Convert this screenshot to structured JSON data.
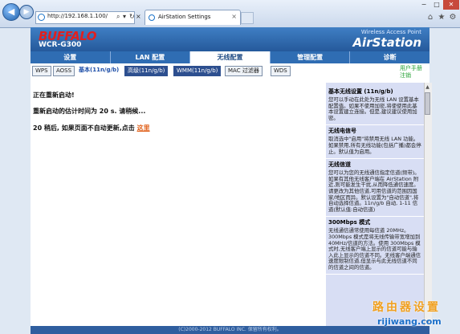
{
  "browser": {
    "url": "http://192.168.1.100/",
    "tab_title": "AirStation Settings",
    "tab_close": "×",
    "search_glyph": "⌕",
    "dropdown_glyph": "▾",
    "refresh_glyph": "↻",
    "stop_glyph": "×",
    "back_glyph": "◀",
    "forward_glyph": "▶",
    "minimize_glyph": "−",
    "maximize_glyph": "□",
    "close_glyph": "✕",
    "home_glyph": "⌂",
    "favorites_glyph": "★",
    "tools_glyph": "⚙"
  },
  "header": {
    "brand": "BUFFALO",
    "model": "WCR-G300",
    "product_sub": "Wireless Access Point",
    "product_name": "AirStation"
  },
  "nav": {
    "tabs": [
      {
        "label": "设置"
      },
      {
        "label": "LAN 配置"
      },
      {
        "label": "无线配置"
      },
      {
        "label": "管理配置"
      },
      {
        "label": "诊断"
      }
    ]
  },
  "subnav": {
    "items": [
      "WPS",
      "AOSS",
      "基本(11n/g/b)",
      "高级(11n/g/b)",
      "WMM(11n/g/b)",
      "MAC 过滤器",
      "WDS"
    ],
    "user_manual": "用户手册",
    "logout": "注销"
  },
  "main": {
    "line1": "正在重新启动!",
    "line2": "重新启动的估计时间为 20 s. 请稍候...",
    "line3": "20 稍后, 如果页面不自动更新,点击",
    "link": "这里"
  },
  "help": {
    "sections": [
      {
        "title": "基本无线设置 (11n/g/b)",
        "body": "您可以手动在此处为无线 LAN 设置基本配置值。如果不使用加密,将使使用此基本设置建立连接。但是,建议建议使用加密。"
      },
      {
        "title": "无线电信号",
        "body": "取消选中\"启用\"将禁用无线 LAN 功能。如果禁用,所有无线功能(包括广播)都会停止。默认值为启用。"
      },
      {
        "title": "无线信道",
        "body": "您可以为您的无线通信指定信道(频带)。如果有其他无线客户端在 AirStation 附近,则可能发生干扰,从而降低通信速度。请更改为其他信道,可用信道的范围因国家/地区而异。默认设置为\"自动信道\",将自动选择信道。11n/g/b 自动, 1-11 信道(默认值:自动信道)"
      },
      {
        "title": "300Mbps 模式",
        "body": "无线通信通常使用每信道 20MHz。300Mbps 模式是将无线传输带宽增加到 40MHz/信道的方法。使用 300Mbps 模式时,无线客户端上显示的信道可能与输入此上显示的信道不同。无线客户端通信速度限制信道,但显示与此无线信道不同的信道之间的信道。"
      }
    ]
  },
  "footer": {
    "text": "(C)2000-2012 BUFFALO INC. 保留所有权利。"
  },
  "watermark": {
    "line1": "路由器设置",
    "line2": "rijiwang.com"
  },
  "colors": {
    "nav_bg": "#2f6db3",
    "help_bg": "#d8def4",
    "brand_red": "#e02020",
    "link_orange": "#e0601a"
  }
}
